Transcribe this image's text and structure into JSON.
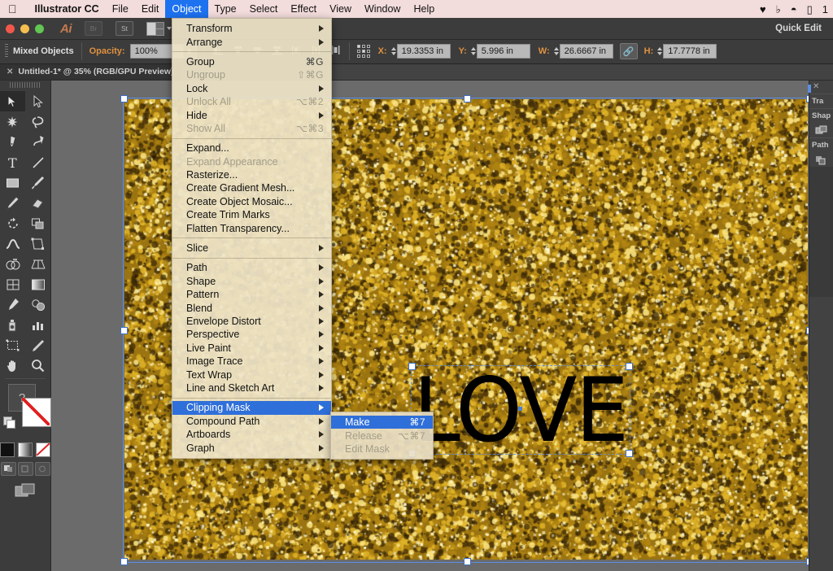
{
  "menubar": {
    "apple_icon": "apple-icon",
    "app_name": "Illustrator CC",
    "items": [
      {
        "label": "File"
      },
      {
        "label": "Edit"
      },
      {
        "label": "Object"
      },
      {
        "label": "Type"
      },
      {
        "label": "Select"
      },
      {
        "label": "Effect"
      },
      {
        "label": "View"
      },
      {
        "label": "Window"
      },
      {
        "label": "Help"
      }
    ],
    "active_item": "Object",
    "status_icons": [
      "dropbox-icon",
      "bluetooth-icon",
      "wifi-icon",
      "airplay-icon"
    ],
    "trailing_text": "1"
  },
  "appbar": {
    "logo": "Ai",
    "bridge_label": "Br",
    "stock_label": "St",
    "arrange_label": "arrange-documents-icon",
    "workspace_name": "Quick Edit"
  },
  "controlbar": {
    "selection_label": "Mixed Objects",
    "opacity_label": "Opacity:",
    "opacity_value": "100%",
    "x_label": "X:",
    "x_value": "19.3353 in",
    "y_label": "Y:",
    "y_value": "5.996 in",
    "w_label": "W:",
    "w_value": "26.6667 in",
    "h_label": "H:",
    "h_value": "17.7778 in",
    "link_icon": "link-proportions-icon",
    "align_icons": [
      "align-left-icon",
      "align-center-horizontal-icon",
      "align-right-icon",
      "align-top-icon",
      "align-middle-icon",
      "align-bottom-icon",
      "distribute-left-icon",
      "distribute-center-icon",
      "distribute-right-icon"
    ],
    "reference_point_icon": "reference-point-selector"
  },
  "tabbar": {
    "tab_title": "Untitled-1* @ 35% (RGB/GPU Preview)",
    "close_icon": "close-icon"
  },
  "toolbar": {
    "tools": [
      "selection-tool",
      "direct-selection-tool",
      "magic-wand-tool",
      "lasso-tool",
      "pen-tool",
      "curvature-tool",
      "type-tool",
      "line-segment-tool",
      "rectangle-tool",
      "paintbrush-tool",
      "pencil-tool",
      "eraser-tool",
      "rotate-tool",
      "scale-tool",
      "width-tool",
      "free-transform-tool",
      "shape-builder-tool",
      "perspective-grid-tool",
      "mesh-tool",
      "gradient-tool",
      "eyedropper-tool",
      "blend-tool",
      "symbol-sprayer-tool",
      "column-graph-tool",
      "artboard-tool",
      "slice-tool",
      "hand-tool",
      "zoom-tool"
    ],
    "selected_tool": "selection-tool",
    "fill_label": "?",
    "stroke_label": "none-swatch",
    "color_swatches": [
      "color-swatch",
      "gradient-swatch",
      "none-swatch"
    ],
    "draw_modes": [
      "draw-normal",
      "draw-behind",
      "draw-inside"
    ],
    "screen_mode": "change-screen-mode"
  },
  "right_panel": {
    "close_icon": "close-icon",
    "sections": [
      {
        "title": "Tra",
        "icon": "transform-icon"
      },
      {
        "title": "Shap",
        "icon": "shape-icon"
      },
      {
        "title": "Path",
        "icon": "pathfinder-icon"
      }
    ]
  },
  "object_menu": {
    "groups": [
      [
        {
          "label": "Transform",
          "shortcut": "",
          "submenu": true,
          "disabled": false
        },
        {
          "label": "Arrange",
          "shortcut": "",
          "submenu": true,
          "disabled": false
        }
      ],
      [
        {
          "label": "Group",
          "shortcut": "⌘G",
          "submenu": false,
          "disabled": false
        },
        {
          "label": "Ungroup",
          "shortcut": "⇧⌘G",
          "submenu": false,
          "disabled": true
        },
        {
          "label": "Lock",
          "shortcut": "",
          "submenu": true,
          "disabled": false
        },
        {
          "label": "Unlock All",
          "shortcut": "⌥⌘2",
          "submenu": false,
          "disabled": true
        },
        {
          "label": "Hide",
          "shortcut": "",
          "submenu": true,
          "disabled": false
        },
        {
          "label": "Show All",
          "shortcut": "⌥⌘3",
          "submenu": false,
          "disabled": true
        }
      ],
      [
        {
          "label": "Expand...",
          "shortcut": "",
          "submenu": false,
          "disabled": false
        },
        {
          "label": "Expand Appearance",
          "shortcut": "",
          "submenu": false,
          "disabled": true
        },
        {
          "label": "Rasterize...",
          "shortcut": "",
          "submenu": false,
          "disabled": false
        },
        {
          "label": "Create Gradient Mesh...",
          "shortcut": "",
          "submenu": false,
          "disabled": false
        },
        {
          "label": "Create Object Mosaic...",
          "shortcut": "",
          "submenu": false,
          "disabled": false
        },
        {
          "label": "Create Trim Marks",
          "shortcut": "",
          "submenu": false,
          "disabled": false
        },
        {
          "label": "Flatten Transparency...",
          "shortcut": "",
          "submenu": false,
          "disabled": false
        }
      ],
      [
        {
          "label": "Slice",
          "shortcut": "",
          "submenu": true,
          "disabled": false
        }
      ],
      [
        {
          "label": "Path",
          "shortcut": "",
          "submenu": true,
          "disabled": false
        },
        {
          "label": "Shape",
          "shortcut": "",
          "submenu": true,
          "disabled": false
        },
        {
          "label": "Pattern",
          "shortcut": "",
          "submenu": true,
          "disabled": false
        },
        {
          "label": "Blend",
          "shortcut": "",
          "submenu": true,
          "disabled": false
        },
        {
          "label": "Envelope Distort",
          "shortcut": "",
          "submenu": true,
          "disabled": false
        },
        {
          "label": "Perspective",
          "shortcut": "",
          "submenu": true,
          "disabled": false
        },
        {
          "label": "Live Paint",
          "shortcut": "",
          "submenu": true,
          "disabled": false
        },
        {
          "label": "Image Trace",
          "shortcut": "",
          "submenu": true,
          "disabled": false
        },
        {
          "label": "Text Wrap",
          "shortcut": "",
          "submenu": true,
          "disabled": false
        },
        {
          "label": "Line and Sketch Art",
          "shortcut": "",
          "submenu": true,
          "disabled": false
        }
      ],
      [
        {
          "label": "Clipping Mask",
          "shortcut": "",
          "submenu": true,
          "disabled": false,
          "highlighted": true
        },
        {
          "label": "Compound Path",
          "shortcut": "",
          "submenu": true,
          "disabled": false
        },
        {
          "label": "Artboards",
          "shortcut": "",
          "submenu": true,
          "disabled": false
        },
        {
          "label": "Graph",
          "shortcut": "",
          "submenu": true,
          "disabled": false
        }
      ]
    ]
  },
  "clipping_mask_submenu": {
    "items": [
      {
        "label": "Make",
        "shortcut": "⌘7",
        "disabled": false,
        "highlighted": true
      },
      {
        "label": "Release",
        "shortcut": "⌥⌘7",
        "disabled": true,
        "highlighted": false
      },
      {
        "label": "Edit Mask",
        "shortcut": "",
        "disabled": true,
        "highlighted": false
      }
    ]
  },
  "canvas": {
    "artwork_text": "LOVE",
    "artwork_description": "gold-glitter-image",
    "background_color": "#6b6b6b",
    "selection_color": "#5b8fe0"
  }
}
